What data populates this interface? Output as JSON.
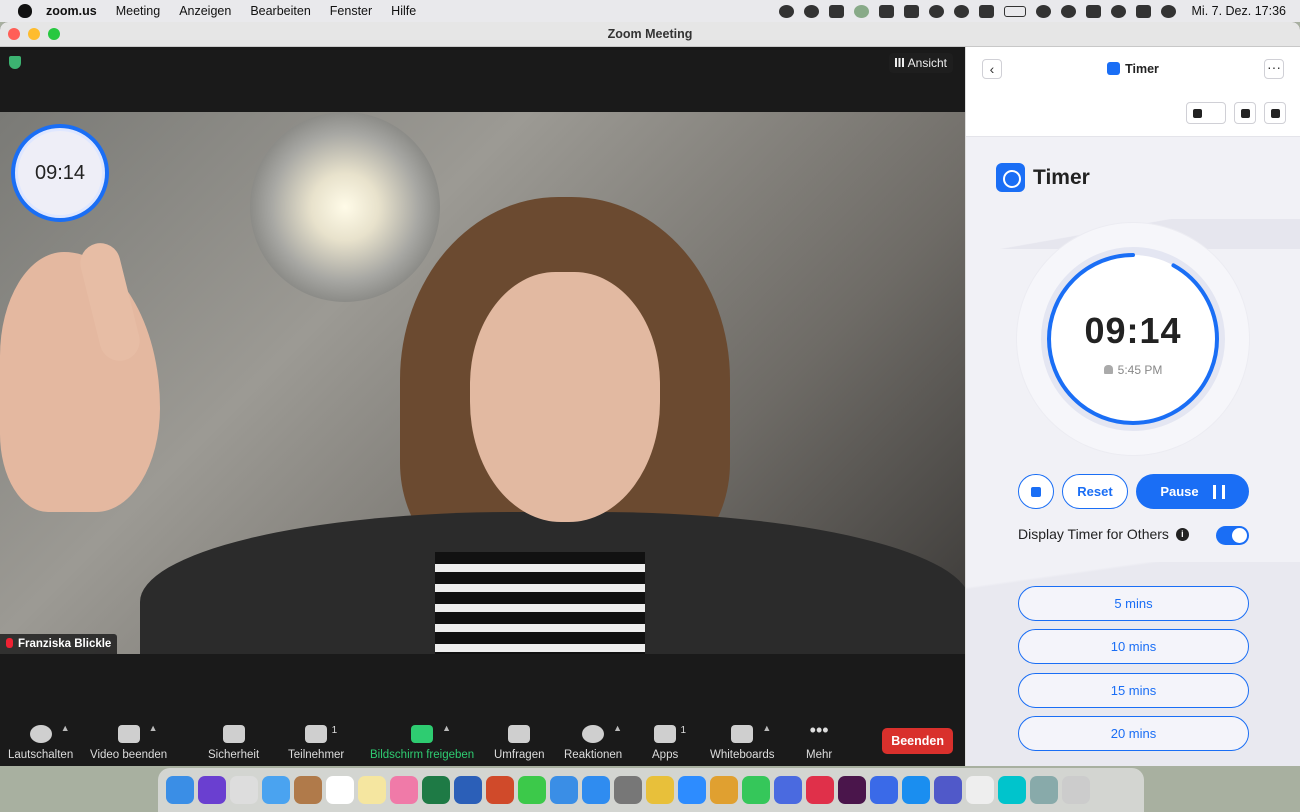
{
  "menubar": {
    "app": "zoom.us",
    "items": [
      "Meeting",
      "Anzeigen",
      "Bearbeiten",
      "Fenster",
      "Hilfe"
    ],
    "clock": "Mi. 7. Dez.  17:36"
  },
  "window": {
    "title": "Zoom Meeting"
  },
  "video": {
    "view_label": "Ansicht",
    "participant_name": "Franziska Blickle",
    "mini_timer": "09:14"
  },
  "toolbar": {
    "mute": "Lautschalten",
    "video": "Video beenden",
    "security": "Sicherheit",
    "participants": "Teilnehmer",
    "participants_count": "1",
    "share": "Bildschirm freigeben",
    "polls": "Umfragen",
    "reactions": "Reaktionen",
    "apps": "Apps",
    "apps_count": "1",
    "whiteboards": "Whiteboards",
    "more": "Mehr",
    "end": "Beenden"
  },
  "panel": {
    "header_title": "Timer",
    "app_title": "Timer",
    "time": "09:14",
    "end_time": "5:45 PM",
    "reset": "Reset",
    "pause": "Pause",
    "display_label": "Display Timer for Others",
    "display_enabled": true,
    "progress_fraction": 0.92,
    "presets": [
      "5 mins",
      "10 mins",
      "15 mins",
      "20 mins"
    ]
  },
  "colors": {
    "accent": "#1a6ef5",
    "end_button": "#d9302c",
    "share_green": "#2ecc71"
  }
}
